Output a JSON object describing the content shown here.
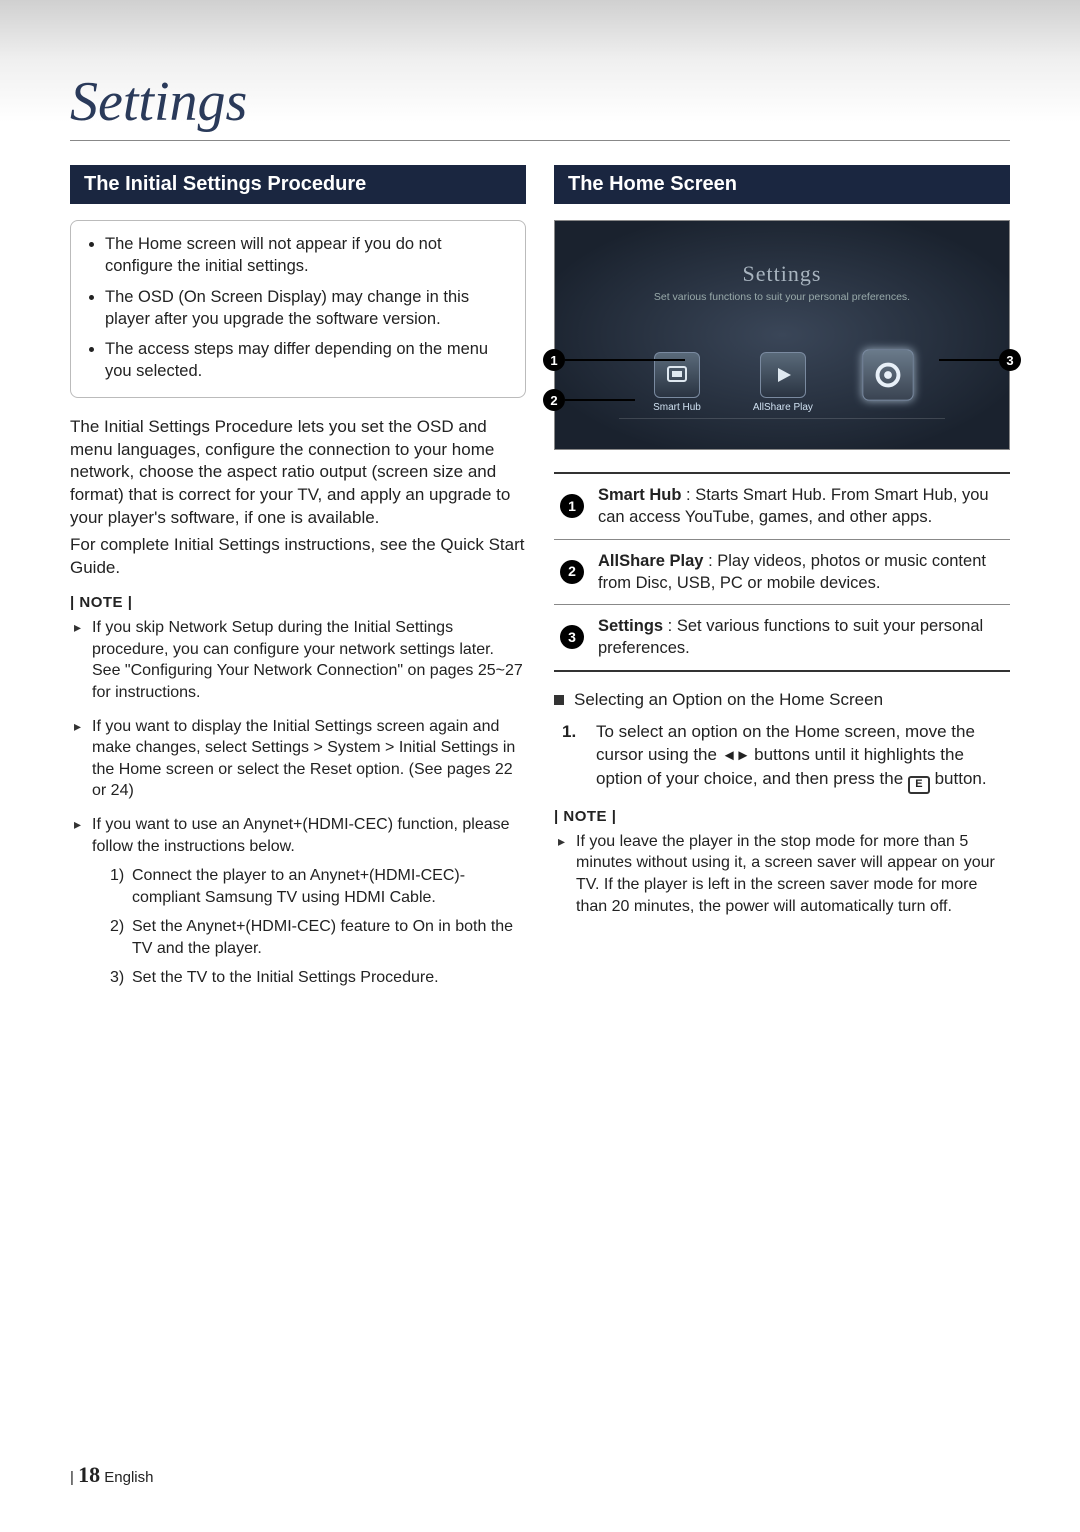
{
  "page_title": "Settings",
  "footer": {
    "divider": "|",
    "page_number": "18",
    "language": "English"
  },
  "left": {
    "header": "The Initial Settings Procedure",
    "box_bullets": [
      "The Home screen will not appear if you do not configure the initial settings.",
      "The OSD (On Screen Display) may change in this player after you upgrade the software version.",
      "The access steps may differ depending on the menu you selected."
    ],
    "para1": "The Initial Settings Procedure lets you set the OSD and menu languages, configure the connection to your home network, choose the aspect ratio output (screen size and format) that is correct for your TV, and apply an upgrade to your player's software, if one is available.",
    "para2": "For complete Initial Settings instructions, see the Quick Start Guide.",
    "note_label": "| NOTE |",
    "notes": [
      "If you skip Network Setup during the Initial Settings procedure, you can configure your network settings later. See \"Configuring Your Network Connection\" on pages 25~27 for instructions.",
      "If you want to display the Initial Settings screen again and make changes, select Settings > System > Initial Settings in the Home screen or select the Reset option. (See pages 22 or 24)",
      "If you want to use an Anynet+(HDMI-CEC) function, please follow the instructions below."
    ],
    "sub_steps": [
      {
        "n": "1)",
        "t": "Connect the player to an Anynet+(HDMI-CEC)-compliant Samsung TV using HDMI Cable."
      },
      {
        "n": "2)",
        "t": "Set the Anynet+(HDMI-CEC) feature to On in both the TV and the player."
      },
      {
        "n": "3)",
        "t": "Set the TV to the Initial Settings Procedure."
      }
    ]
  },
  "right": {
    "header": "The Home Screen",
    "tv": {
      "title": "Settings",
      "subtitle": "Set various functions to suit your personal preferences.",
      "items": [
        {
          "label": "Smart Hub",
          "glyph": "⬚"
        },
        {
          "label": "AllShare Play",
          "glyph": "▷"
        },
        {
          "label": "",
          "glyph": "⚙"
        }
      ],
      "callouts": {
        "c1": "1",
        "c2": "2",
        "c3": "3"
      }
    },
    "legend": [
      {
        "n": "1",
        "bold": "Smart Hub",
        "rest": " : Starts Smart Hub. From Smart Hub, you can access YouTube, games, and other apps."
      },
      {
        "n": "2",
        "bold": "AllShare Play",
        "rest": " : Play videos, photos or music content from Disc, USB, PC or mobile devices."
      },
      {
        "n": "3",
        "bold": "Settings",
        "rest": " : Set various functions to suit your personal preferences."
      }
    ],
    "select_heading": "Selecting an Option on the Home Screen",
    "step1_n": "1.",
    "step1_a": "To select an option on the Home screen, move the cursor using the ",
    "step1_arrows": "◄►",
    "step1_b": " buttons until it highlights the option of your choice, and then press the ",
    "step1_enter": "E",
    "step1_c": " button.",
    "note_label": "| NOTE |",
    "notes": [
      "If you leave the player in the stop mode for more than 5 minutes without using it, a screen saver will appear on your TV. If the player is left in the screen saver mode for more than 20 minutes, the power will automatically turn off."
    ]
  }
}
